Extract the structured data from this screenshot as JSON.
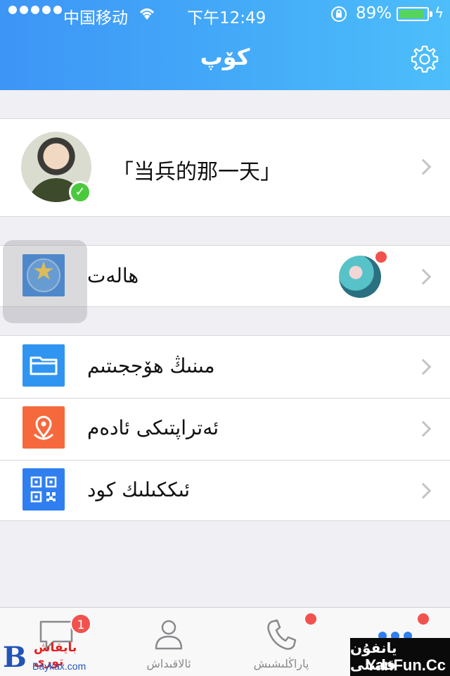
{
  "status_bar": {
    "carrier": "中国移动",
    "time": "下午12:49",
    "battery_percent": "89%",
    "battery_level": 0.89,
    "signal_bars": 5
  },
  "header": {
    "title": "كۆپ",
    "settings_icon": "gear-icon"
  },
  "profile": {
    "name": "「当兵的那一天」",
    "verified": true
  },
  "menu_groups": [
    {
      "items": [
        {
          "label": "ھالەت",
          "icon": "qzone-star-icon",
          "has_new_dot": true
        }
      ]
    },
    {
      "items": [
        {
          "label": "مىنىڭ ھۆججىتىم",
          "icon": "folder-icon"
        },
        {
          "label": "ئەتراپتىكى ئادەم",
          "icon": "location-pin-icon"
        },
        {
          "label": "ئىككىلىك كود",
          "icon": "qr-code-icon"
        }
      ]
    }
  ],
  "tabbar": {
    "tabs": [
      {
        "label": "",
        "icon": "chat-bubble-icon",
        "badge": "1"
      },
      {
        "label": "ئالاقىداش",
        "icon": "person-icon"
      },
      {
        "label": "پاراڭلىشىش",
        "icon": "phone-icon",
        "dot": true
      },
      {
        "label": "",
        "icon": "more-dots-icon",
        "dot": true,
        "active": true
      }
    ]
  },
  "watermarks": {
    "left_text": "بايقاش تورى",
    "left_url": "Baykax.com",
    "right_text": "يانفۇن قانىلى",
    "right_url": "YanFun.Cc"
  },
  "colors": {
    "header_blue": "#3d95f6",
    "badge_red": "#f2524e",
    "verified_green": "#4cc83e"
  }
}
